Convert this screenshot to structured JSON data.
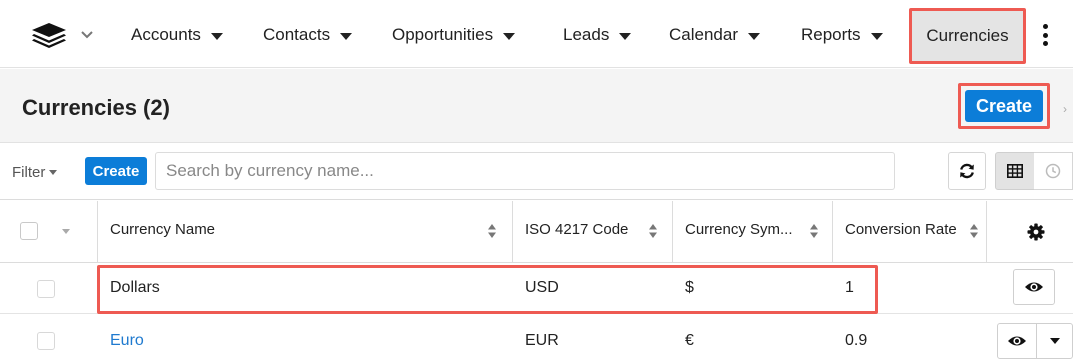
{
  "nav": {
    "items": [
      {
        "label": "Accounts"
      },
      {
        "label": "Contacts"
      },
      {
        "label": "Opportunities"
      },
      {
        "label": "Leads"
      },
      {
        "label": "Calendar"
      },
      {
        "label": "Reports"
      }
    ],
    "active_item": "Currencies",
    "icons": {
      "logo": "layers-icon",
      "logo_menu": "chevron-down-icon",
      "more": "kebab-icon"
    }
  },
  "header": {
    "title": "Currencies (2)",
    "create_label": "Create"
  },
  "filterbar": {
    "filter_label": "Filter",
    "create_label": "Create",
    "search_placeholder": "Search by currency name...",
    "icons": {
      "refresh": "refresh-icon",
      "list_view": "grid-icon",
      "timeline_view": "clock-icon"
    }
  },
  "table": {
    "columns": [
      {
        "label": "Currency Name"
      },
      {
        "label": "ISO 4217 Code"
      },
      {
        "label": "Currency Sym..."
      },
      {
        "label": "Conversion Rate"
      }
    ],
    "settings_icon": "gear-icon",
    "rows": [
      {
        "name": "Dollars",
        "iso": "USD",
        "symbol": "$",
        "rate": "1",
        "highlighted": true
      },
      {
        "name": "Euro",
        "iso": "EUR",
        "symbol": "€",
        "rate": "0.9",
        "highlighted": false
      }
    ]
  },
  "colors": {
    "accent": "#0c7dd8",
    "highlight": "#ee5a52",
    "link": "#1f7acf"
  }
}
